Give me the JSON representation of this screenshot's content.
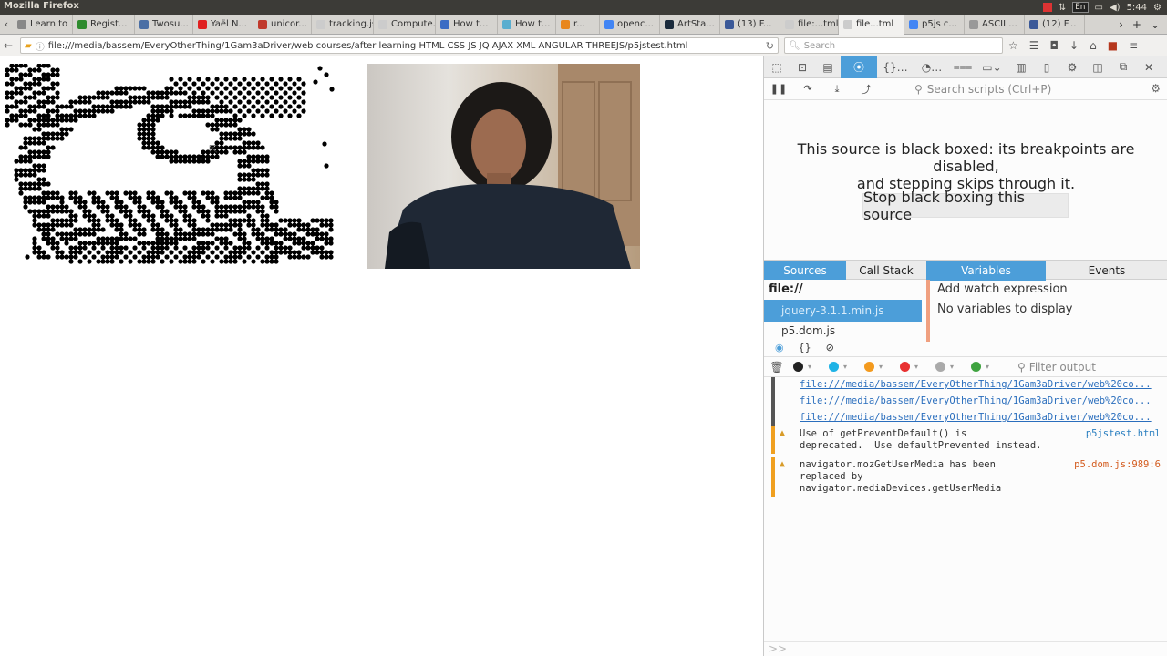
{
  "titlebar": {
    "title": "Mozilla Firefox",
    "lang": "En",
    "time": "5:44"
  },
  "tabs": [
    {
      "label": "Learn to ...",
      "color": "#888888"
    },
    {
      "label": "Regist...",
      "color": "#2e8b2e"
    },
    {
      "label": "Twosu...",
      "color": "#4a6fa5"
    },
    {
      "label": "Yaël N...",
      "color": "#e02020"
    },
    {
      "label": "unicor...",
      "color": "#c0392b"
    },
    {
      "label": "tracking.js",
      "color": "#cccccc"
    },
    {
      "label": "Compute...",
      "color": "#cccccc"
    },
    {
      "label": "How t...",
      "color": "#3b6cc4"
    },
    {
      "label": "How t...",
      "color": "#5aaecf"
    },
    {
      "label": "r...",
      "color": "#e8871e"
    },
    {
      "label": "openc...",
      "color": "#4285f4"
    },
    {
      "label": "ArtSta...",
      "color": "#1a2b3c"
    },
    {
      "label": "(13) F...",
      "color": "#3b5998"
    },
    {
      "label": "file:...tml#",
      "color": "#cccccc"
    },
    {
      "label": "file...tml",
      "color": "#cccccc",
      "active": true
    },
    {
      "label": "p5js c...",
      "color": "#4285f4"
    },
    {
      "label": "ASCII ...",
      "color": "#999999"
    },
    {
      "label": "(12) F...",
      "color": "#3b5998"
    }
  ],
  "nav": {
    "url": "file:///media/bassem/EveryOtherThing/1Gam3aDriver/web courses/after learning HTML CSS JS JQ AJAX XML ANGULAR THREEJS/p5jstest.html",
    "search_placeholder": "Search"
  },
  "debugger": {
    "search_placeholder": "Search scripts (Ctrl+P)",
    "blackbox_line1": "This source is black boxed: its breakpoints are disabled,",
    "blackbox_line2": "and stepping skips through it.",
    "unblackbox_button": "Stop black boxing this source"
  },
  "panes": {
    "tabs": [
      "Sources",
      "Call Stack",
      "Variables",
      "Events"
    ],
    "source_root": "file://",
    "selected_source": "jquery-3.1.1.min.js",
    "next_source": "p5.dom.js",
    "watch_placeholder": "Add watch expression",
    "no_variables": "No variables to display"
  },
  "console": {
    "filter_placeholder": "Filter output",
    "filter_colors": [
      "#222222",
      "#1fb3e6",
      "#f39a1e",
      "#e83030",
      "#aaaaaa",
      "#3fa340"
    ],
    "links": [
      "file:///media/bassem/EveryOtherThing/1Gam3aDriver/web%20co...",
      "file:///media/bassem/EveryOtherThing/1Gam3aDriver/web%20co...",
      "file:///media/bassem/EveryOtherThing/1Gam3aDriver/web%20co..."
    ],
    "warning1": {
      "text": "Use of getPreventDefault() is\ndeprecated.  Use defaultPrevented instead.",
      "loc": "p5jstest.html"
    },
    "warning2": {
      "text": "navigator.mozGetUserMedia has been\nreplaced by\nnavigator.mediaDevices.getUserMedia",
      "loc": "p5.dom.js:989:6"
    },
    "prompt": ">>"
  },
  "colors": {
    "accent": "#4c9ed9",
    "warning": "#d89b28"
  }
}
